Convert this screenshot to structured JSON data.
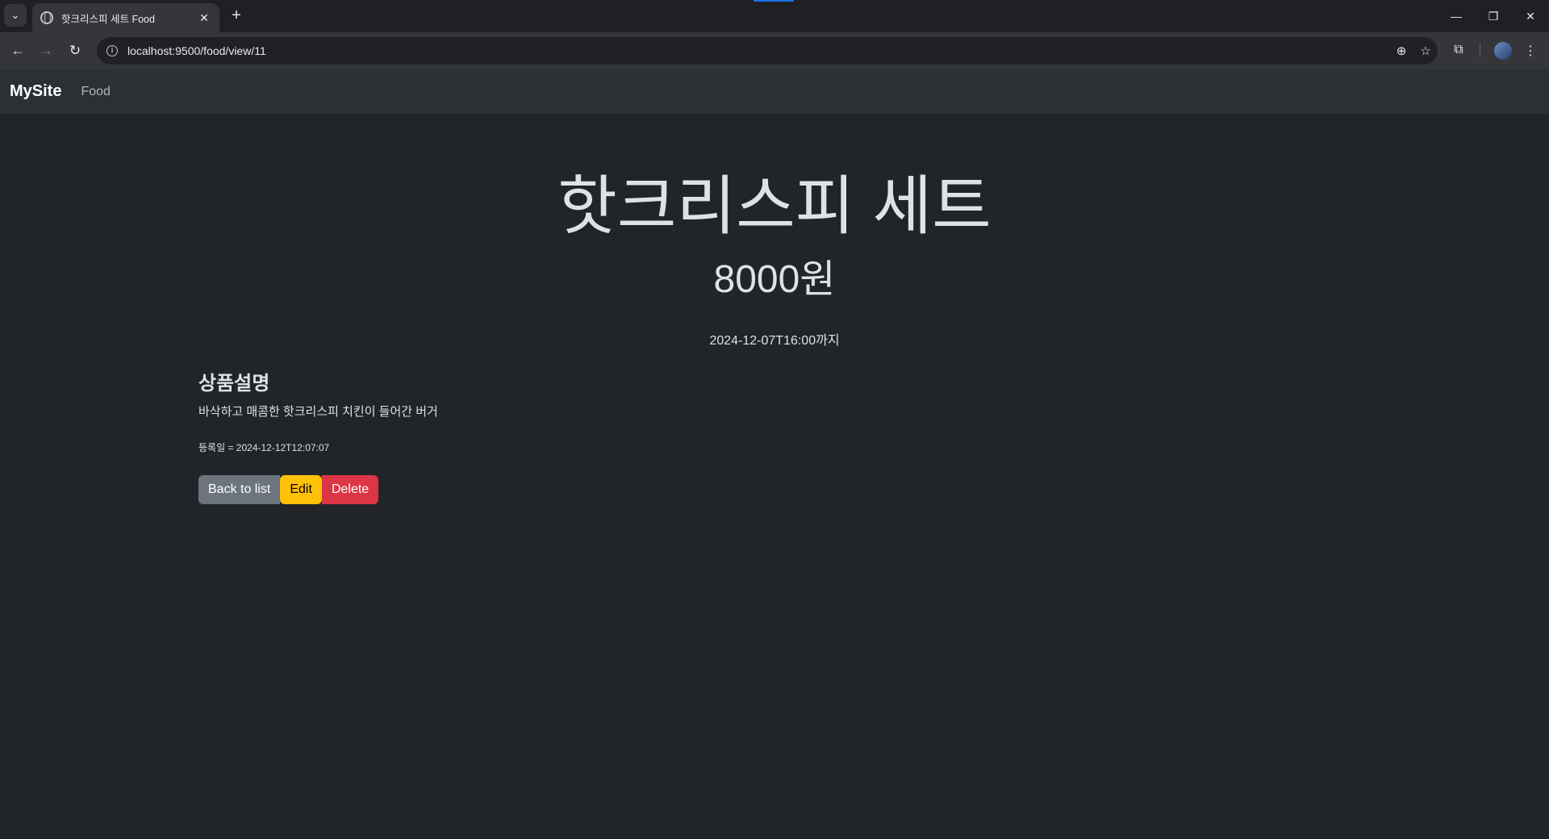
{
  "browser": {
    "tab_title": "핫크리스피 세트 Food",
    "url": "localhost:9500/food/view/11",
    "icons": [
      "tab-search-icon",
      "globe-icon",
      "close-icon",
      "plus-icon",
      "minimize-icon",
      "restore-icon",
      "close-window-icon",
      "back-icon",
      "forward-icon",
      "reload-icon",
      "info-icon",
      "zoom-icon",
      "star-icon",
      "extensions-icon",
      "menu-icon"
    ]
  },
  "navbar": {
    "brand": "MySite",
    "links": [
      "Food"
    ]
  },
  "food": {
    "name": "핫크리스피 세트",
    "price": "8000원",
    "deadline": "2024-12-07T16:00까지",
    "description_heading": "상품설명",
    "description": "바삭하고 매콤한 핫크리스피 치킨이 들어간 버거",
    "registered": "등록일 = 2024-12-12T12:07:07"
  },
  "actions": {
    "back_label": "Back to list",
    "edit_label": "Edit",
    "delete_label": "Delete"
  },
  "colors": {
    "page_bg": "#212529",
    "navbar_bg": "#2b3035",
    "btn_secondary": "#6c757d",
    "btn_warning": "#ffc107",
    "btn_danger": "#dc3545"
  }
}
